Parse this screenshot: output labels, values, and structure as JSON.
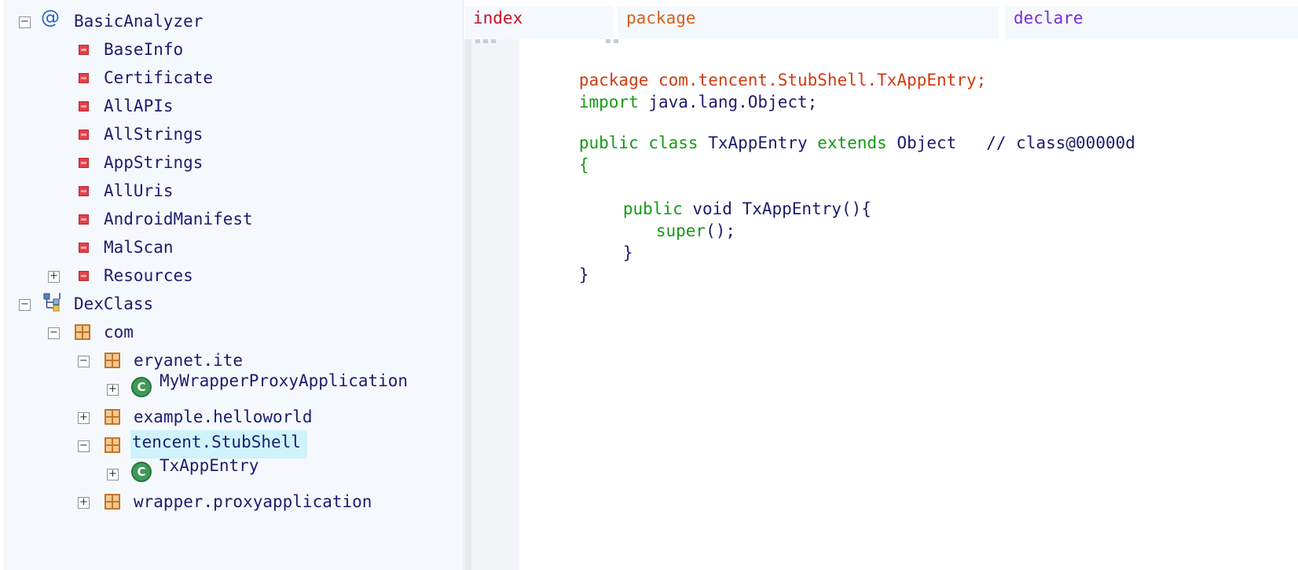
{
  "tree": {
    "nodes": [
      {
        "key": "basic",
        "toggle": "−",
        "label": "BasicAnalyzer",
        "icon": "at-icon"
      },
      {
        "key": "baseinfo",
        "toggle": "",
        "label": "BaseInfo",
        "icon": "red-square-icon"
      },
      {
        "key": "certificate",
        "toggle": "",
        "label": "Certificate",
        "icon": "red-square-icon"
      },
      {
        "key": "allapis",
        "toggle": "",
        "label": "AllAPIs",
        "icon": "red-square-icon"
      },
      {
        "key": "allstrings",
        "toggle": "",
        "label": "AllStrings",
        "icon": "red-square-icon"
      },
      {
        "key": "appstrings",
        "toggle": "",
        "label": "AppStrings",
        "icon": "red-square-icon"
      },
      {
        "key": "alluris",
        "toggle": "",
        "label": "AllUris",
        "icon": "red-square-icon"
      },
      {
        "key": "manifest",
        "toggle": "",
        "label": "AndroidManifest",
        "icon": "red-square-icon"
      },
      {
        "key": "malscan",
        "toggle": "",
        "label": "MalScan",
        "icon": "red-square-icon"
      },
      {
        "key": "resources",
        "toggle": "+",
        "label": "Resources",
        "icon": "red-square-icon"
      },
      {
        "key": "dexclass",
        "toggle": "−",
        "label": "DexClass",
        "icon": "hierarchy-icon"
      },
      {
        "key": "com",
        "toggle": "−",
        "label": "com",
        "icon": "package-icon"
      },
      {
        "key": "eryanet",
        "toggle": "−",
        "label": "eryanet.ite",
        "icon": "package-icon"
      },
      {
        "key": "mywrapper",
        "toggle": "+",
        "label": "MyWrapperProxyApplication",
        "icon": "class-icon"
      },
      {
        "key": "example",
        "toggle": "+",
        "label": "example.helloworld",
        "icon": "package-icon"
      },
      {
        "key": "tencent",
        "toggle": "−",
        "label": "tencent.StubShell",
        "icon": "package-icon",
        "selected": true
      },
      {
        "key": "txappentry",
        "toggle": "+",
        "label": "TxAppEntry",
        "icon": "class-icon"
      },
      {
        "key": "wrapper",
        "toggle": "+",
        "label": "wrapper.proxyapplication",
        "icon": "package-icon"
      }
    ],
    "class_icon_glyph": "C",
    "at_glyph": "@"
  },
  "code": {
    "columns": [
      {
        "label": "index",
        "color": "#c8102e"
      },
      {
        "label": "package",
        "color": "#d4601c"
      },
      {
        "label": "declare",
        "color": "#7a2bd6"
      }
    ],
    "lines": [
      {
        "key": "l1",
        "parts": [
          {
            "t": "package com.tencent.StubShell.TxAppEntry;",
            "c": "kw-red"
          }
        ]
      },
      {
        "key": "l2",
        "parts": [
          {
            "t": "import",
            "c": "kw-green"
          },
          {
            "t": " java.lang.Object;",
            "c": "plain"
          }
        ]
      },
      {
        "key": "l3",
        "parts": [
          {
            "t": "public class",
            "c": "kw-green"
          },
          {
            "t": " TxAppEntry ",
            "c": "plain"
          },
          {
            "t": "extends",
            "c": "kw-green"
          },
          {
            "t": " Object   // class@00000d",
            "c": "plain"
          }
        ]
      },
      {
        "key": "l4",
        "parts": [
          {
            "t": "{",
            "c": "kw-green"
          }
        ]
      },
      {
        "key": "l5",
        "parts": [
          {
            "t": "public",
            "c": "kw-green"
          },
          {
            "t": " void TxAppEntry(){",
            "c": "plain"
          }
        ]
      },
      {
        "key": "l6",
        "parts": [
          {
            "t": "super",
            "c": "kw-green"
          },
          {
            "t": "();",
            "c": "plain"
          }
        ]
      },
      {
        "key": "l7",
        "parts": [
          {
            "t": "}",
            "c": "plain"
          }
        ]
      },
      {
        "key": "l8",
        "parts": [
          {
            "t": "}",
            "c": "plain"
          }
        ]
      }
    ]
  }
}
